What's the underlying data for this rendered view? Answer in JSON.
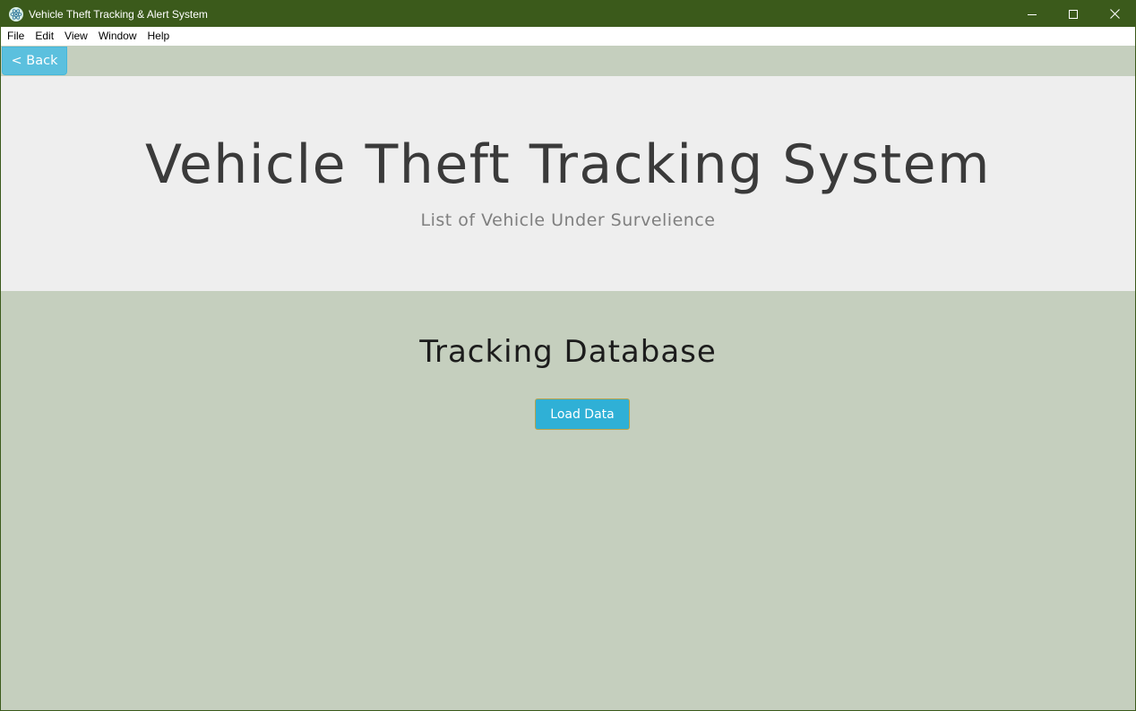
{
  "window": {
    "title": "Vehicle Theft Tracking & Alert System",
    "app_icon": "electron-atom-icon",
    "controls": [
      "minimize-icon",
      "maximize-icon",
      "close-icon"
    ]
  },
  "menubar": {
    "items": [
      "File",
      "Edit",
      "View",
      "Window",
      "Help"
    ]
  },
  "nav": {
    "back_label": "< Back"
  },
  "header": {
    "title": "Vehicle Theft Tracking System",
    "subtitle": "List of Vehicle Under Survelience"
  },
  "main": {
    "section_title": "Tracking Database",
    "load_button_label": "Load Data"
  },
  "colors": {
    "titlebar": "#3b5a1b",
    "background": "#c5cfbe",
    "jumbotron": "#eeeeee",
    "back_button": "#5bc0de",
    "load_button": "#2fb0d6"
  }
}
